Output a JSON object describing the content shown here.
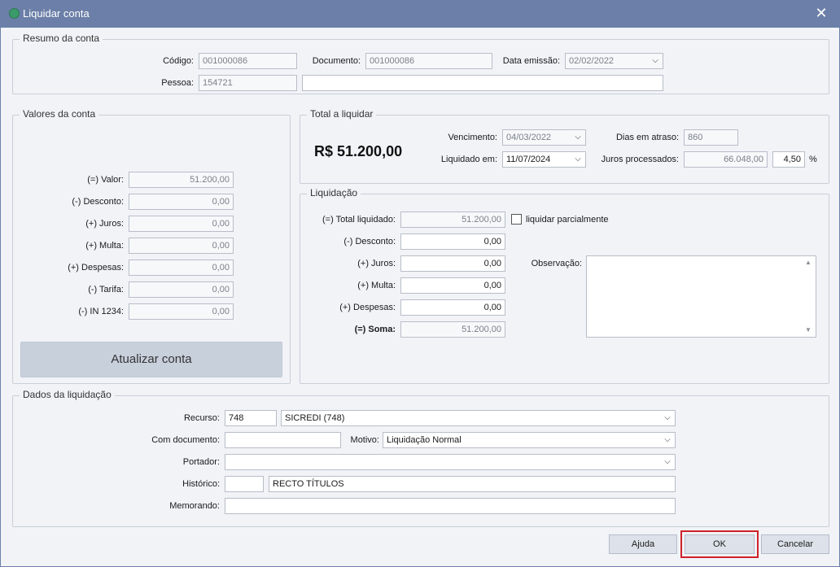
{
  "window": {
    "title": "Liquidar conta",
    "close_glyph": "✕"
  },
  "resumo": {
    "legend": "Resumo da conta",
    "codigo_label": "Código:",
    "codigo_value": "001000086",
    "documento_label": "Documento:",
    "documento_value": "001000086",
    "data_emissao_label": "Data emissão:",
    "data_emissao_value": "02/02/2022",
    "pessoa_label": "Pessoa:",
    "pessoa_value": "154721",
    "pessoa_nome": ""
  },
  "valores": {
    "legend": "Valores da conta",
    "rows": [
      {
        "label": "(=) Valor:",
        "value": "51.200,00"
      },
      {
        "label": "(-) Desconto:",
        "value": "0,00"
      },
      {
        "label": "(+) Juros:",
        "value": "0,00"
      },
      {
        "label": "(+) Multa:",
        "value": "0,00"
      },
      {
        "label": "(+) Despesas:",
        "value": "0,00"
      },
      {
        "label": "(-) Tarifa:",
        "value": "0,00"
      },
      {
        "label": "(-) IN 1234:",
        "value": "0,00"
      }
    ],
    "atualizar_label": "Atualizar conta"
  },
  "total": {
    "legend": "Total a liquidar",
    "amount": "R$ 51.200,00",
    "vencimento_label": "Vencimento:",
    "vencimento_value": "04/03/2022",
    "liquidado_label": "Liquidado em:",
    "liquidado_value": "11/07/2024",
    "dias_label": "Dias em atraso:",
    "dias_value": "860",
    "juros_label": "Juros processados:",
    "juros_value": "66.048,00",
    "juros_pct": "4,50",
    "pct_symbol": "%"
  },
  "liquidacao": {
    "legend": "Liquidação",
    "total_label": "(=) Total liquidado:",
    "total_value": "51.200,00",
    "parcial_label": "liquidar parcialmente",
    "desconto_label": "(-) Desconto:",
    "desconto_value": "0,00",
    "juros_label": "(+) Juros:",
    "juros_value": "0,00",
    "multa_label": "(+) Multa:",
    "multa_value": "0,00",
    "despesas_label": "(+) Despesas:",
    "despesas_value": "0,00",
    "soma_label": "(=) Soma:",
    "soma_value": "51.200,00",
    "observacao_label": "Observação:"
  },
  "dados": {
    "legend": "Dados da liquidação",
    "recurso_label": "Recurso:",
    "recurso_code": "748",
    "recurso_name": "SICREDI (748)",
    "com_documento_label": "Com documento:",
    "com_documento_value": "",
    "motivo_label": "Motivo:",
    "motivo_value": "Liquidação Normal",
    "portador_label": "Portador:",
    "portador_value": "",
    "historico_label": "Histórico:",
    "historico_code": "",
    "historico_text": "RECTO TÍTULOS",
    "memorando_label": "Memorando:",
    "memorando_value": ""
  },
  "buttons": {
    "ajuda": "Ajuda",
    "ok": "OK",
    "cancelar": "Cancelar"
  },
  "colors": {
    "titlebar": "#6b7fa8",
    "highlight": "#d0202a"
  }
}
